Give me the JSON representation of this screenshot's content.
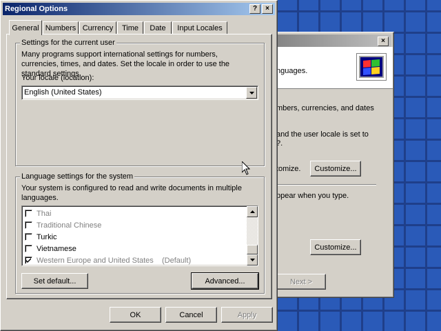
{
  "background_window": {
    "texts": {
      "line1": "nguages.",
      "line2": "mbers, currencies, and dates",
      "line3": "and the user locale is set to",
      "line4": "?.",
      "line5": "tomize.",
      "line6": "ppear when you type."
    },
    "customize_button_1": "Customize...",
    "customize_button_2": "Customize...",
    "next_button": "Next >",
    "close_icon": "×",
    "logo_icon": "windows-flag-icon"
  },
  "dialog": {
    "title": "Regional Options",
    "help_button": "?",
    "close_button": "×",
    "tabs": [
      "General",
      "Numbers",
      "Currency",
      "Time",
      "Date",
      "Input Locales"
    ],
    "user_group": {
      "label": "Settings for the current user",
      "description": "Many programs support international settings for numbers, currencies, times, and dates. Set the locale in order to use the standard settings.",
      "locale_label": "Your locale (location):",
      "locale_value": "English (United States)"
    },
    "system_group": {
      "label": "Language settings for the system",
      "description": "Your system is configured to read and write documents in multiple languages.",
      "languages": [
        {
          "name": "Thai",
          "checked": false,
          "enabled": false
        },
        {
          "name": "Traditional Chinese",
          "checked": false,
          "enabled": false
        },
        {
          "name": "Turkic",
          "checked": false,
          "enabled": true
        },
        {
          "name": "Vietnamese",
          "checked": false,
          "enabled": true
        },
        {
          "name": "Western Europe and United States    (Default)",
          "checked": true,
          "enabled": false
        }
      ],
      "set_default_button": "Set default...",
      "advanced_button": "Advanced..."
    },
    "ok_button": "OK",
    "cancel_button": "Cancel",
    "apply_button": "Apply"
  },
  "colors": {
    "title_active": "#0a246a",
    "face": "#d4d0c8",
    "desktop": "#2a5ab8"
  }
}
